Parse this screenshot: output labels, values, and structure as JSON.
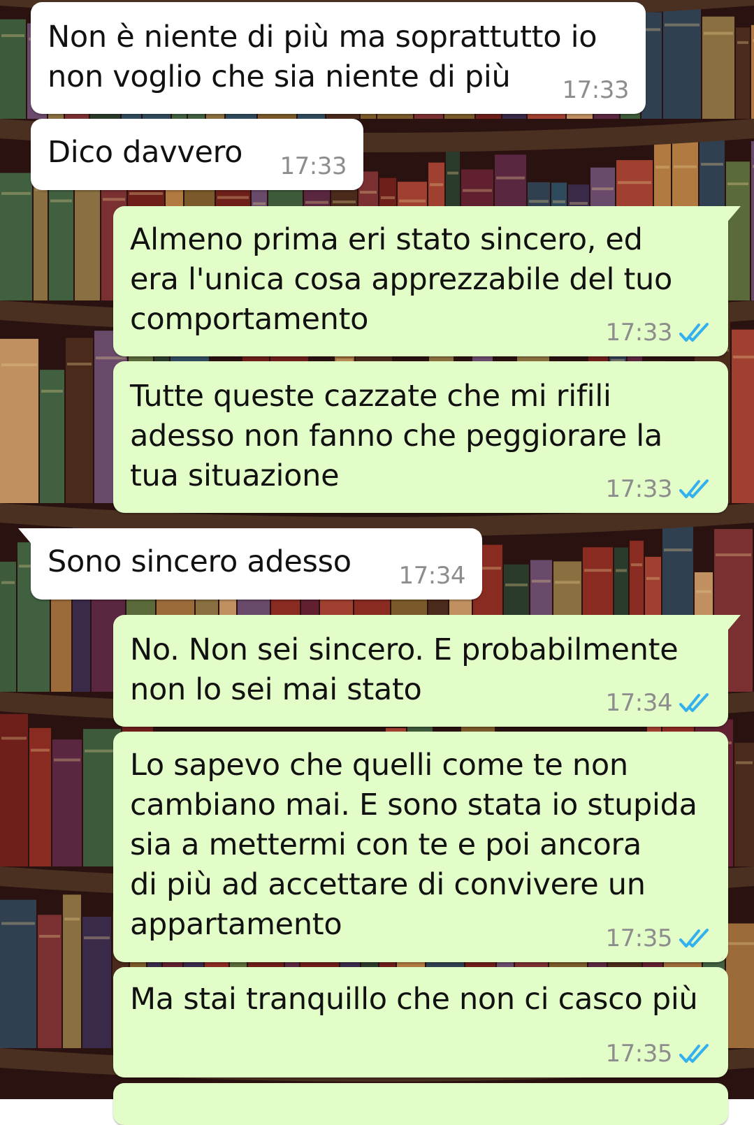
{
  "colors": {
    "incoming_bubble": "#ffffff",
    "outgoing_bubble": "#e2fdc8",
    "read_ticks": "#33b0ee",
    "timestamp": "#8d8d8d"
  },
  "messages": [
    {
      "direction": "in",
      "text": "Non è niente di più ma soprattutto io\nnon voglio che sia niente di più",
      "time": "17:33"
    },
    {
      "direction": "in",
      "text": "Dico davvero",
      "time": "17:33"
    },
    {
      "direction": "out",
      "text": "Almeno prima eri stato sincero, ed\nera l'unica cosa apprezzabile del tuo\ncomportamento",
      "time": "17:33",
      "status": "read",
      "status_icon": "double-check-icon"
    },
    {
      "direction": "out",
      "text": "Tutte queste cazzate che mi rifili\nadesso non fanno che peggiorare la\ntua situazione",
      "time": "17:33",
      "status": "read",
      "status_icon": "double-check-icon"
    },
    {
      "direction": "in",
      "text": "Sono sincero adesso",
      "time": "17:34"
    },
    {
      "direction": "out",
      "text": "No. Non sei sincero. E probabilmente\nnon lo sei mai stato",
      "time": "17:34",
      "status": "read",
      "status_icon": "double-check-icon"
    },
    {
      "direction": "out",
      "text": "Lo sapevo che quelli come te non\ncambiano mai. E sono stata io stupida\nsia a mettermi con te e poi ancora\ndi più ad accettare di convivere un\nappartamento",
      "time": "17:35",
      "status": "read",
      "status_icon": "double-check-icon"
    },
    {
      "direction": "out",
      "text": "Ma stai tranquillo che non ci casco più",
      "time": "17:35",
      "status": "read",
      "status_icon": "double-check-icon"
    }
  ]
}
